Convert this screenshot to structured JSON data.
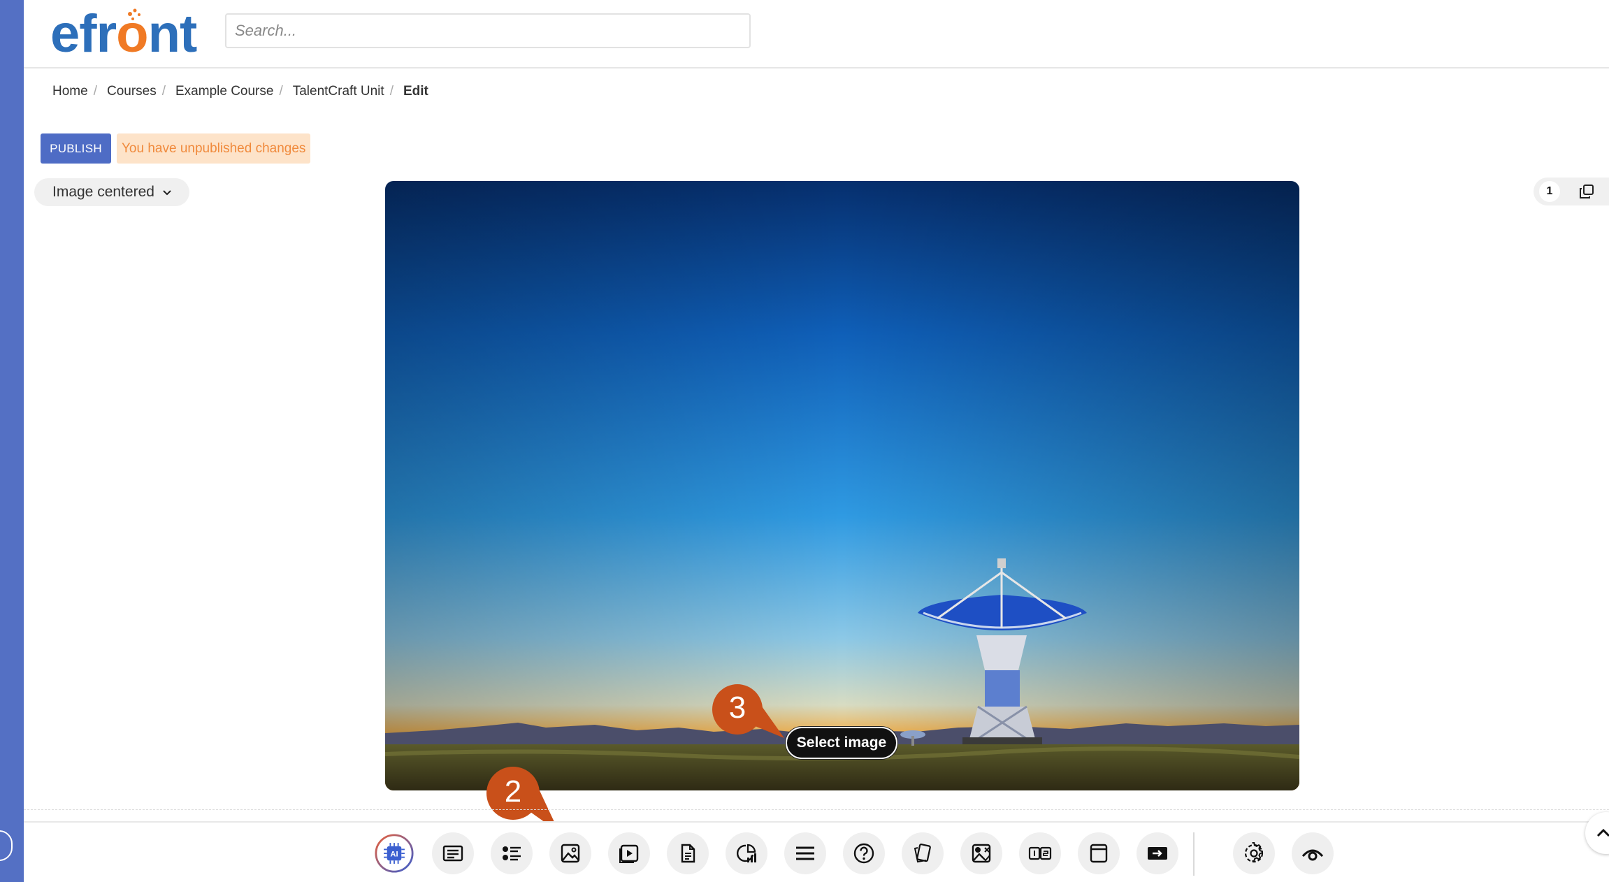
{
  "header": {
    "logo_text_a": "efr",
    "logo_text_o": "o",
    "logo_text_b": "nt",
    "search_placeholder": "Search..."
  },
  "breadcrumb": [
    {
      "label": "Home"
    },
    {
      "label": "Courses"
    },
    {
      "label": "Example Course"
    },
    {
      "label": "TalentCraft Unit"
    },
    {
      "label": "Edit"
    }
  ],
  "editor": {
    "publish_label": "PUBLISH",
    "unpublished_notice": "You have unpublished changes",
    "layout_selected": "Image centered",
    "select_image_label": "Select image",
    "page_number": "1"
  },
  "callouts": [
    {
      "number": "2"
    },
    {
      "number": "3"
    }
  ],
  "toolbar": {
    "tools": [
      {
        "icon": "ai-chip-icon"
      },
      {
        "icon": "text-block-icon"
      },
      {
        "icon": "list-icon"
      },
      {
        "icon": "image-icon"
      },
      {
        "icon": "video-icon"
      },
      {
        "icon": "document-icon"
      },
      {
        "icon": "chart-icon"
      },
      {
        "icon": "lines-icon"
      },
      {
        "icon": "question-icon"
      },
      {
        "icon": "flashcards-icon"
      },
      {
        "icon": "image-quiz-icon"
      },
      {
        "icon": "columns-icon"
      },
      {
        "icon": "frame-icon"
      },
      {
        "icon": "embed-icon"
      },
      {
        "icon": "gear-icon"
      },
      {
        "icon": "eye-icon"
      }
    ]
  },
  "colors": {
    "brand_blue": "#2d6fba",
    "brand_orange": "#f07a25",
    "publish_button": "#4e6cc5",
    "unpublished_bg": "#fde3c9",
    "unpublished_text": "#f08a3c",
    "callout": "#c9501a"
  }
}
